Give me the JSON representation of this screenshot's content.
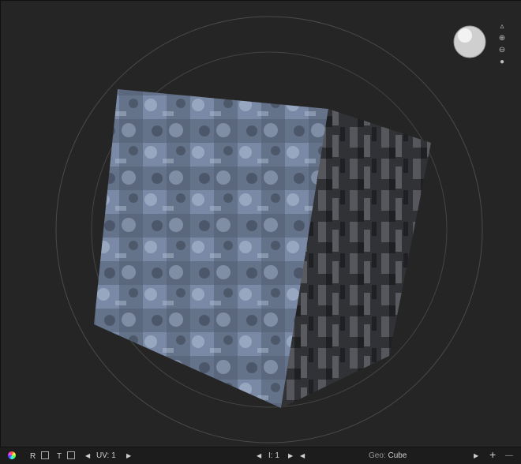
{
  "viewport": {
    "geometry_label": "Geo:",
    "geometry_value": "Cube"
  },
  "side_controls": [
    "up-arrow-icon",
    "zoom-in-icon",
    "zoom-out-icon",
    "dot-icon"
  ],
  "footer": {
    "r_label": "R",
    "t_label": "T",
    "uv_label": "UV: 1",
    "frame_label": "I: 1",
    "geo_label": "Geo:",
    "geo_value": "Cube",
    "add_label": "+",
    "remove_label": "—"
  },
  "colors": {
    "background": "#252525",
    "footer": "#1c1c1c",
    "stone_light": "#8a9bb5",
    "stone_dark": "#2f3035"
  }
}
